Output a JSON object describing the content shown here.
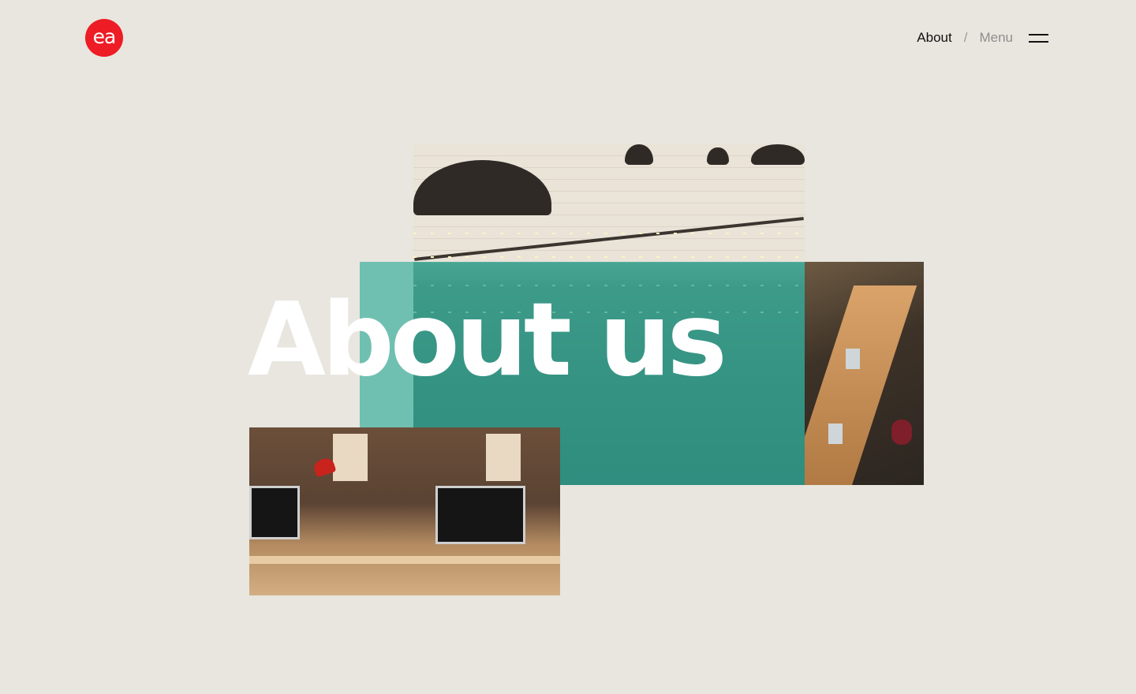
{
  "logo": {
    "text": "ea",
    "color": "#ee1c25"
  },
  "nav": {
    "current": "About",
    "separator": "/",
    "menu_label": "Menu",
    "menu_icon": "hamburger-icon"
  },
  "hero": {
    "title": "About us",
    "accent_color": "#1fa492",
    "photos": [
      "office-string-lights-photo",
      "office-long-desks-photo",
      "office-workstations-photo"
    ]
  },
  "colors": {
    "background": "#e8e6df",
    "title": "#ffffff",
    "nav_active": "#111111",
    "nav_muted": "#8e8e8e"
  }
}
